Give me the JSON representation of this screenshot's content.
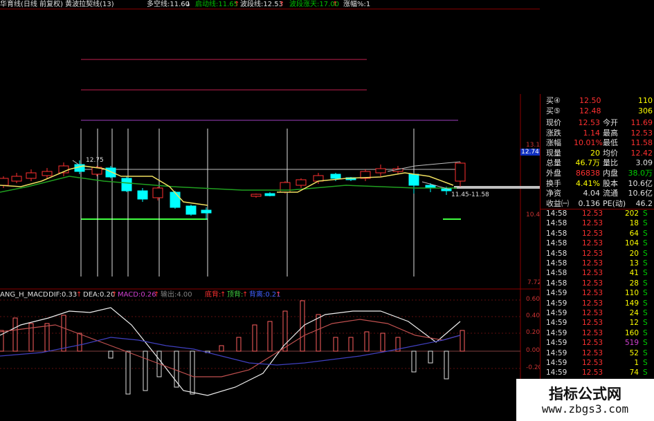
{
  "header": {
    "main_title": "华育线(日线 前复权) 黄波拉契线(13)",
    "items": [
      {
        "label": "多空线:11.60",
        "arrow": "↓",
        "color": "#e0e0e0"
      },
      {
        "label": "启动线:11.65",
        "arrow": "↑",
        "color": "#00c000"
      },
      {
        "label": "波段线:12.53",
        "arrow": "↑",
        "color": "#e0e0e0"
      },
      {
        "label": "波段涨天:17.00",
        "arrow": "↑",
        "color": "#00c000"
      },
      {
        "label": "涨幅%:1",
        "arrow": "",
        "color": "#e0e0e0"
      }
    ]
  },
  "annotations": {
    "high_label": "12.75",
    "range_label": "11.45-11.58",
    "current_price_tag": "12.74"
  },
  "price_axis": {
    "top": "13.14",
    "mid": "10.44",
    "bottom": "7.72"
  },
  "macd": {
    "title": "ANG_H_MACD",
    "dif": "DIF:0.33",
    "dea": "DEA:0.20",
    "macd": "MACD:0.26",
    "out": "输出:4.00",
    "low_buy": "底背:",
    "top_buy": "顶背:",
    "div": "背离:0.21",
    "axis": [
      "0.60",
      "0.40",
      "0.20",
      "0.00",
      "-0.20"
    ]
  },
  "quote": {
    "bids": [
      {
        "label": "买④",
        "price": "12.50",
        "vol": "110"
      },
      {
        "label": "买⑤",
        "price": "12.48",
        "vol": "306"
      }
    ],
    "rows": [
      {
        "l1": "现价",
        "v1": "12.53",
        "l2": "今开",
        "v2": "11.69",
        "c1": "#ff3030",
        "c2": "#ff3030"
      },
      {
        "l1": "涨跌",
        "v1": "1.14",
        "l2": "最高",
        "v2": "12.53",
        "c1": "#ff3030",
        "c2": "#ff3030"
      },
      {
        "l1": "涨幅",
        "v1": "10.01%",
        "l2": "最低",
        "v2": "11.58",
        "c1": "#ff3030",
        "c2": "#ff3030"
      },
      {
        "l1": "现量",
        "v1": "20",
        "l2": "均价",
        "v2": "12.42",
        "c1": "#ffff00",
        "c2": "#ff3030"
      },
      {
        "l1": "总量",
        "v1": "46.7万",
        "l2": "量比",
        "v2": "3.09",
        "c1": "#ffff00",
        "c2": "#e0e0e0"
      },
      {
        "l1": "外盘",
        "v1": "86838",
        "l2": "内盘",
        "v2": "38.0万",
        "c1": "#ff3030",
        "c2": "#00d000"
      },
      {
        "l1": "换手",
        "v1": "4.41%",
        "l2": "股本",
        "v2": "10.6亿",
        "c1": "#ffff00",
        "c2": "#e0e0e0"
      },
      {
        "l1": "净资",
        "v1": "4.04",
        "l2": "流通",
        "v2": "10.6亿",
        "c1": "#e0e0e0",
        "c2": "#e0e0e0"
      },
      {
        "l1": "收益㈠",
        "v1": "0.136",
        "l2": "PE(动)",
        "v2": "46.2",
        "c1": "#e0e0e0",
        "c2": "#e0e0e0"
      }
    ],
    "ticks": [
      {
        "t": "14:58",
        "p": "12.53",
        "v": "202",
        "s": "S"
      },
      {
        "t": "14:58",
        "p": "12.53",
        "v": "18",
        "s": "S"
      },
      {
        "t": "14:58",
        "p": "12.53",
        "v": "64",
        "s": "S"
      },
      {
        "t": "14:58",
        "p": "12.53",
        "v": "104",
        "s": "S"
      },
      {
        "t": "14:58",
        "p": "12.53",
        "v": "20",
        "s": "S"
      },
      {
        "t": "14:58",
        "p": "12.53",
        "v": "13",
        "s": "S"
      },
      {
        "t": "14:58",
        "p": "12.53",
        "v": "41",
        "s": "S"
      },
      {
        "t": "14:58",
        "p": "12.53",
        "v": "28",
        "s": "S"
      },
      {
        "t": "14:59",
        "p": "12.53",
        "v": "110",
        "s": "S"
      },
      {
        "t": "14:59",
        "p": "12.53",
        "v": "149",
        "s": "S"
      },
      {
        "t": "14:59",
        "p": "12.53",
        "v": "24",
        "s": "S"
      },
      {
        "t": "14:59",
        "p": "12.53",
        "v": "12",
        "s": "S"
      },
      {
        "t": "14:59",
        "p": "12.53",
        "v": "160",
        "s": "S"
      },
      {
        "t": "14:59",
        "p": "12.53",
        "v": "519",
        "s": "S"
      },
      {
        "t": "14:59",
        "p": "12.53",
        "v": "52",
        "s": "S"
      },
      {
        "t": "14:59",
        "p": "12.53",
        "v": "1",
        "s": "S"
      },
      {
        "t": "14:59",
        "p": "12.53",
        "v": "74",
        "s": "S"
      }
    ]
  },
  "watermark": {
    "line1": "指标公式网",
    "line2": "www.zbgs3.com"
  },
  "colors": {
    "up": "#ff3030",
    "down": "#00ffff",
    "frame": "#8b0000"
  }
}
